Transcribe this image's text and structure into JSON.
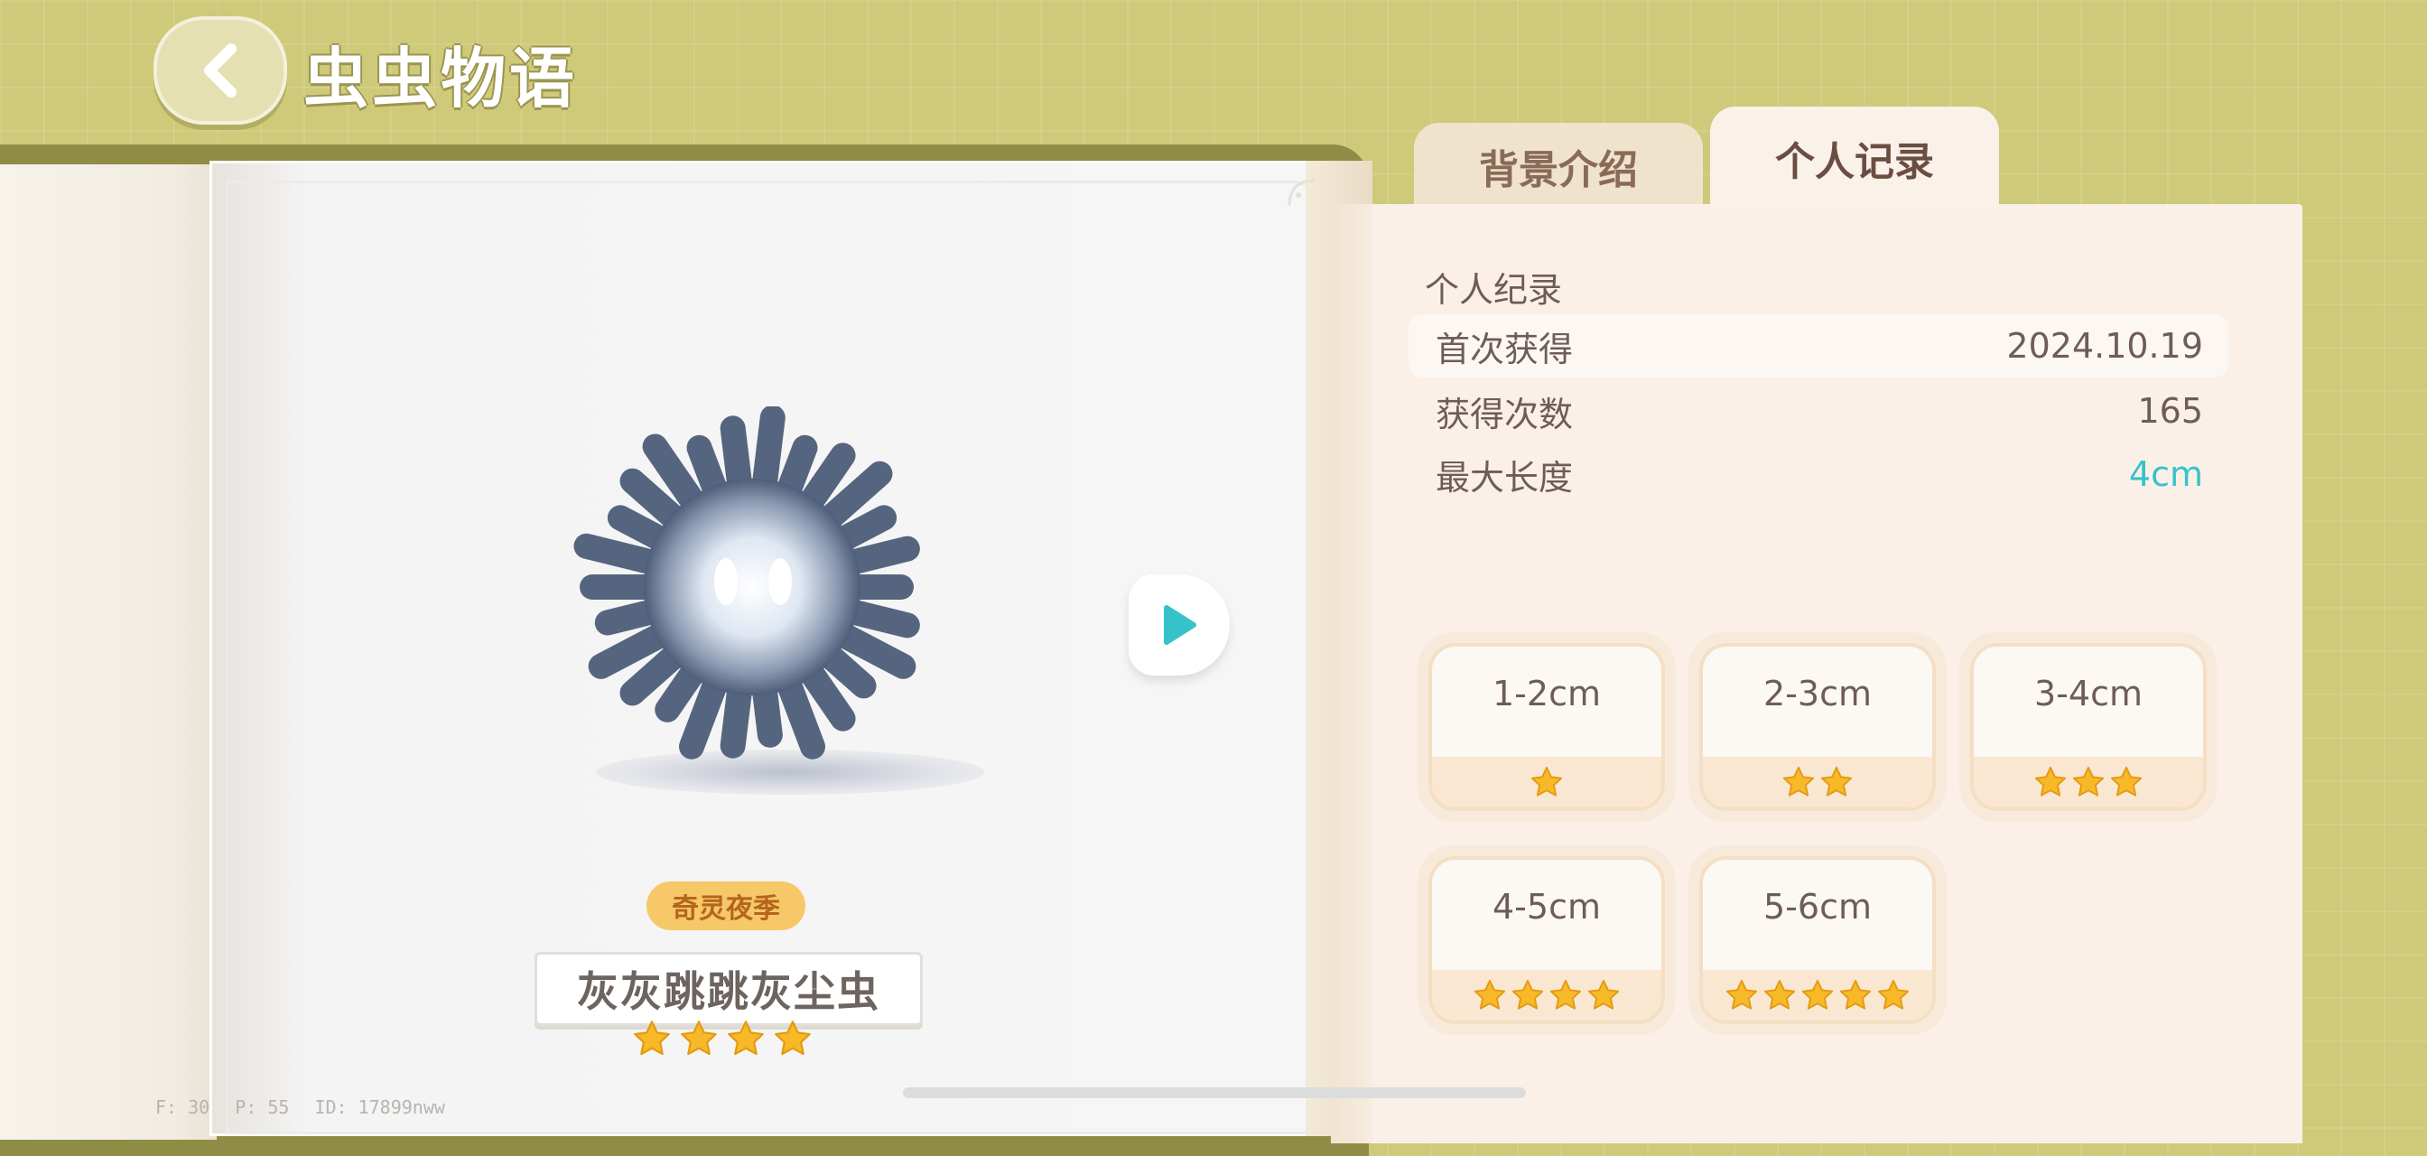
{
  "header": {
    "title": "虫虫物语"
  },
  "creature": {
    "season_badge": "奇灵夜季",
    "name": "灰灰跳跳灰尘虫",
    "stars": 4
  },
  "tabs": [
    {
      "label": "背景介绍",
      "active": false
    },
    {
      "label": "个人记录",
      "active": true
    }
  ],
  "record": {
    "section_title": "个人纪录",
    "rows": [
      {
        "label": "首次获得",
        "value": "2024.10.19"
      },
      {
        "label": "获得次数",
        "value": "165"
      },
      {
        "label": "最大长度",
        "value": "4cm"
      }
    ]
  },
  "size_cards": [
    {
      "label": "1-2cm",
      "stars": 1
    },
    {
      "label": "2-3cm",
      "stars": 2
    },
    {
      "label": "3-4cm",
      "stars": 3
    },
    {
      "label": "4-5cm",
      "stars": 4
    },
    {
      "label": "5-6cm",
      "stars": 5
    }
  ],
  "debug": {
    "f": "F: 30",
    "p": "P: 55",
    "id": "ID: 17899nww"
  },
  "colors": {
    "accent": "#35c3c9",
    "star": "#f7b928",
    "background": "#cfc97a"
  },
  "icons": {
    "back": "chevron-left-icon",
    "play": "play-icon",
    "star": "star-icon"
  }
}
